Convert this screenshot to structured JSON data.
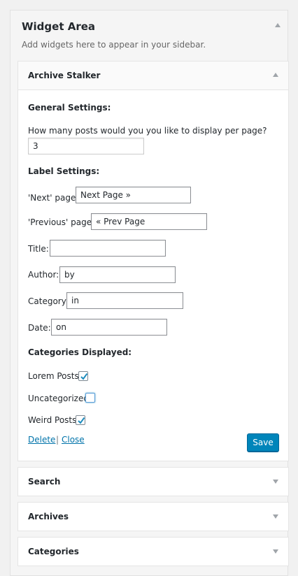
{
  "widget_area": {
    "title": "Widget Area",
    "description": "Add widgets here to appear in your sidebar."
  },
  "archive_stalker": {
    "title": "Archive Stalker",
    "general_heading": "General Settings:",
    "posts_per_page_label": "How many posts would you you like to display per page?",
    "posts_per_page_value": "3",
    "label_heading": "Label Settings:",
    "next_label": "'Next' page:",
    "next_value": "Next Page »",
    "prev_label": "'Previous' page:",
    "prev_value": "« Prev Page",
    "title_label": "Title:",
    "title_value": "",
    "author_label": "Author:",
    "author_value": "by",
    "category_label": "Category:",
    "category_value": "in",
    "date_label": "Date:",
    "date_value": "on",
    "categories_heading": "Categories Displayed:",
    "categories": [
      {
        "label": "Lorem Posts",
        "checked": true
      },
      {
        "label": "Uncategorized",
        "checked": false
      },
      {
        "label": "Weird Posts",
        "checked": true
      }
    ],
    "delete_label": "Delete",
    "separator": "|",
    "close_label": "Close",
    "save_label": "Save"
  },
  "collapsed_widgets": [
    {
      "title": "Search"
    },
    {
      "title": "Archives"
    },
    {
      "title": "Categories"
    }
  ],
  "colors": {
    "accent": "#0085ba",
    "link": "#0073aa",
    "checkmark": "#1e8cbe"
  }
}
